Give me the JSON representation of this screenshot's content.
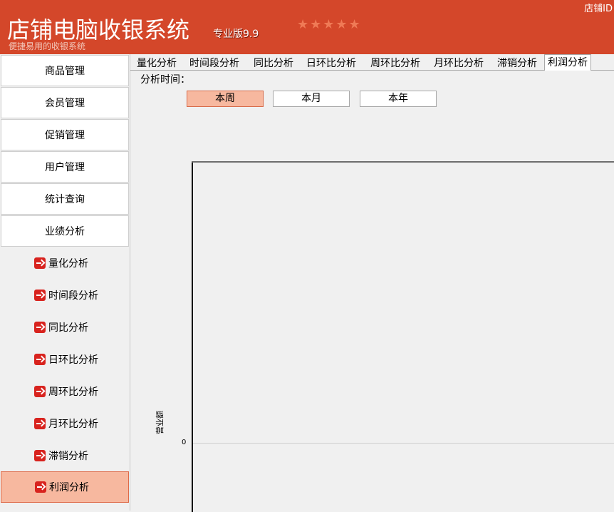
{
  "header": {
    "title": "店铺电脑收银系统",
    "edition": "专业版9.9",
    "subtitle": "便捷易用的收银系统",
    "stars": "★★★★★",
    "store_id": "店铺ID"
  },
  "sidebar": {
    "menus": [
      {
        "label": "商品管理"
      },
      {
        "label": "会员管理"
      },
      {
        "label": "促销管理"
      },
      {
        "label": "用户管理"
      },
      {
        "label": "统计查询"
      },
      {
        "label": "业绩分析"
      }
    ],
    "sub_items": [
      {
        "label": "量化分析"
      },
      {
        "label": "时间段分析"
      },
      {
        "label": "同比分析"
      },
      {
        "label": "日环比分析"
      },
      {
        "label": "周环比分析"
      },
      {
        "label": "月环比分析"
      },
      {
        "label": "滞销分析"
      },
      {
        "label": "利润分析"
      }
    ],
    "active_sub": "利润分析"
  },
  "tabs": [
    {
      "label": "量化分析"
    },
    {
      "label": "时间段分析"
    },
    {
      "label": "同比分析"
    },
    {
      "label": "日环比分析"
    },
    {
      "label": "周环比分析"
    },
    {
      "label": "月环比分析"
    },
    {
      "label": "滞销分析"
    },
    {
      "label": "利润分析"
    }
  ],
  "active_tab": "利润分析",
  "analysis": {
    "time_label": "分析时间：",
    "periods": [
      {
        "label": "本周"
      },
      {
        "label": "本月"
      },
      {
        "label": "本年"
      }
    ],
    "active_period": "本周"
  },
  "chart_data": {
    "type": "bar",
    "categories": [],
    "values": [],
    "ylabel": "营业额",
    "yticks": [
      "0"
    ]
  },
  "colors": {
    "header_bg": "#d4472a",
    "active_bg": "#f7b89f",
    "arrow_icon": "#d8231e"
  }
}
